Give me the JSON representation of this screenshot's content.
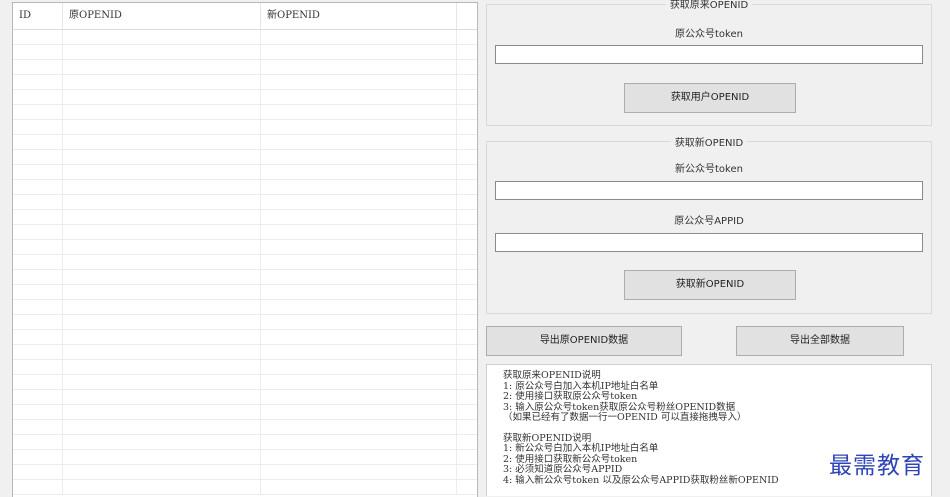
{
  "grid": {
    "columns": [
      "ID",
      "原OPENID",
      "新OPENID"
    ],
    "row_count": 31
  },
  "get_original": {
    "group_title": "获取原来OPENID",
    "token_label": "原公众号token",
    "token_value": "",
    "button": "获取用户OPENID"
  },
  "get_new": {
    "group_title": "获取新OPENID",
    "token_label": "新公众号token",
    "token_value": "",
    "appid_label": "原公众号APPID",
    "appid_value": "",
    "button": "获取新OPENID"
  },
  "export": {
    "original_button": "导出原OPENID数据",
    "all_button": "导出全部数据"
  },
  "notes": {
    "lines": [
      "获取原来OPENID说明",
      "1: 原公众号白加入本机IP地址白名单",
      "2: 使用接口获取原公众号token",
      "3: 输入原公众号token获取原公众号粉丝OPENID数据",
      "（如果已经有了数据一行一OPENID 可以直接拖拽导入）",
      "",
      "获取新OPENID说明",
      "1: 新公众号白加入本机IP地址白名单",
      "2: 使用接口获取新公众号token",
      "3: 必须知道原公众号APPID",
      "4: 输入新公众号token 以及原公众号APPID获取粉丝新OPENID"
    ]
  },
  "watermark": "最需教育"
}
